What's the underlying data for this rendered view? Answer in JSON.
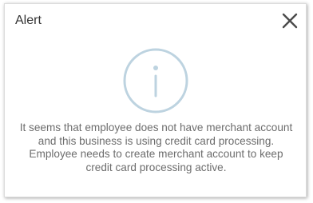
{
  "dialog": {
    "title": "Alert",
    "close_icon": "close-icon",
    "status_icon": "info-icon",
    "message": "It seems that employee does not have merchant account and this business is using credit card processing. Employee needs to create merchant account to keep credit card processing active.",
    "colors": {
      "icon": "#bdd3e0",
      "text": "#6d6d6d",
      "title": "#333333",
      "close": "#4a4a4a"
    }
  }
}
